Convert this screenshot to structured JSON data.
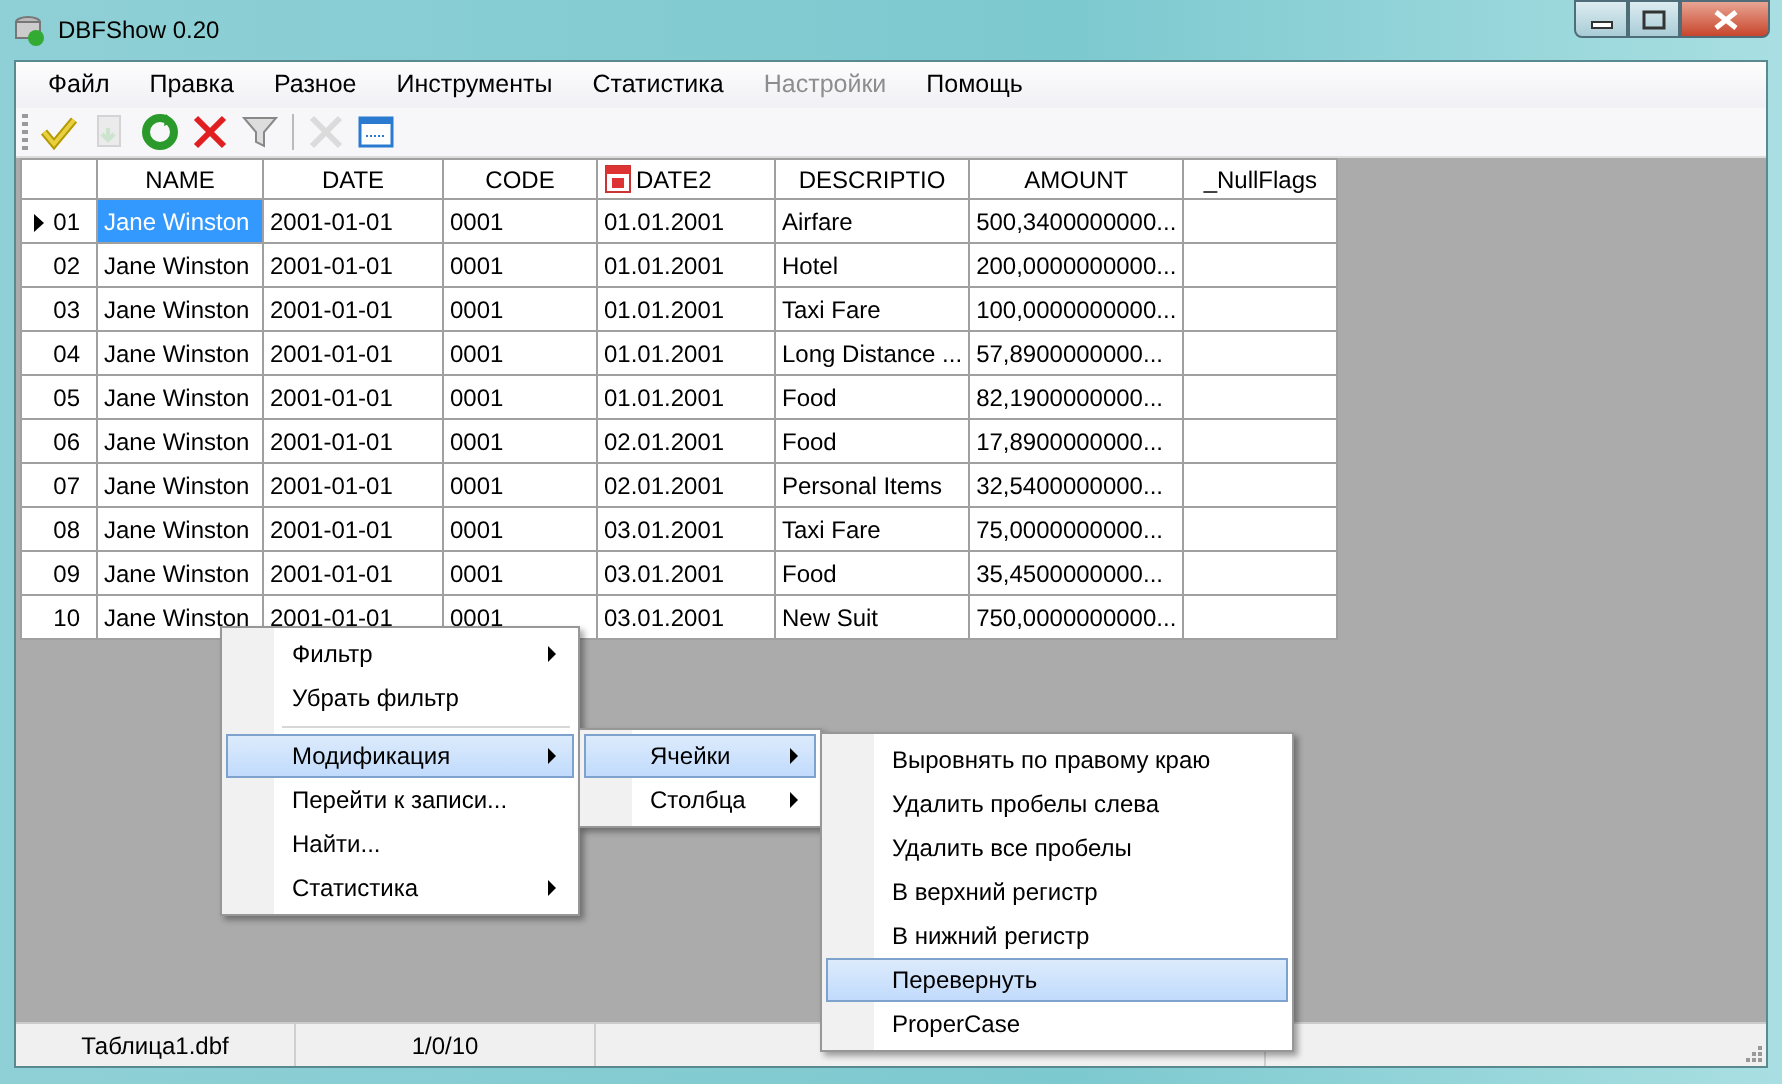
{
  "window": {
    "title": "DBFShow 0.20"
  },
  "menu": [
    {
      "label": "Файл",
      "disabled": false
    },
    {
      "label": "Правка",
      "disabled": false
    },
    {
      "label": "Разное",
      "disabled": false
    },
    {
      "label": "Инструменты",
      "disabled": false
    },
    {
      "label": "Статистика",
      "disabled": false
    },
    {
      "label": "Настройки",
      "disabled": true
    },
    {
      "label": "Помощь",
      "disabled": false
    }
  ],
  "toolbar": [
    {
      "kind": "open",
      "disabled": false
    },
    {
      "kind": "export",
      "disabled": true
    },
    {
      "kind": "refresh",
      "disabled": false
    },
    {
      "kind": "delete",
      "disabled": false
    },
    {
      "kind": "filter",
      "disabled": false
    },
    {
      "kind": "separator"
    },
    {
      "kind": "tools",
      "disabled": true
    },
    {
      "kind": "window",
      "disabled": false
    }
  ],
  "grid": {
    "columns": [
      {
        "label": "NAME",
        "kind": "text"
      },
      {
        "label": "DATE",
        "kind": "text"
      },
      {
        "label": "CODE",
        "kind": "text"
      },
      {
        "label": "DATE2",
        "kind": "date"
      },
      {
        "label": "DESCRIPTIO",
        "kind": "text"
      },
      {
        "label": "AMOUNT",
        "kind": "text"
      },
      {
        "label": "_NullFlags",
        "kind": "text"
      }
    ],
    "rows": [
      {
        "header": "01",
        "current": true,
        "cells": [
          {
            "text": "Jane Winston",
            "selected": true
          },
          {
            "text": "2001-01-01",
            "selected": false
          },
          {
            "text": "0001",
            "selected": false
          },
          {
            "text": "01.01.2001",
            "selected": false
          },
          {
            "text": "Airfare",
            "selected": false
          },
          {
            "text": "500,3400000000...",
            "selected": false
          },
          {
            "text": "",
            "selected": false
          }
        ]
      },
      {
        "header": "02",
        "current": false,
        "cells": [
          {
            "text": "Jane Winston",
            "selected": false
          },
          {
            "text": "2001-01-01",
            "selected": false
          },
          {
            "text": "0001",
            "selected": false
          },
          {
            "text": "01.01.2001",
            "selected": false
          },
          {
            "text": "Hotel",
            "selected": false
          },
          {
            "text": "200,0000000000...",
            "selected": false
          },
          {
            "text": "",
            "selected": false
          }
        ]
      },
      {
        "header": "03",
        "current": false,
        "cells": [
          {
            "text": "Jane Winston",
            "selected": false
          },
          {
            "text": "2001-01-01",
            "selected": false
          },
          {
            "text": "0001",
            "selected": false
          },
          {
            "text": "01.01.2001",
            "selected": false
          },
          {
            "text": "Taxi Fare",
            "selected": false
          },
          {
            "text": "100,0000000000...",
            "selected": false
          },
          {
            "text": "",
            "selected": false
          }
        ]
      },
      {
        "header": "04",
        "current": false,
        "cells": [
          {
            "text": "Jane Winston",
            "selected": false
          },
          {
            "text": "2001-01-01",
            "selected": false
          },
          {
            "text": "0001",
            "selected": false
          },
          {
            "text": "01.01.2001",
            "selected": false
          },
          {
            "text": "Long Distance ...",
            "selected": false
          },
          {
            "text": "57,8900000000...",
            "selected": false
          },
          {
            "text": "",
            "selected": false
          }
        ]
      },
      {
        "header": "05",
        "current": false,
        "cells": [
          {
            "text": "Jane Winston",
            "selected": false
          },
          {
            "text": "2001-01-01",
            "selected": false
          },
          {
            "text": "0001",
            "selected": false
          },
          {
            "text": "01.01.2001",
            "selected": false
          },
          {
            "text": "Food",
            "selected": false
          },
          {
            "text": "82,1900000000...",
            "selected": false
          },
          {
            "text": "",
            "selected": false
          }
        ]
      },
      {
        "header": "06",
        "current": false,
        "cells": [
          {
            "text": "Jane Winston",
            "selected": false
          },
          {
            "text": "2001-01-01",
            "selected": false
          },
          {
            "text": "0001",
            "selected": false
          },
          {
            "text": "02.01.2001",
            "selected": false
          },
          {
            "text": "Food",
            "selected": false
          },
          {
            "text": "17,8900000000...",
            "selected": false
          },
          {
            "text": "",
            "selected": false
          }
        ]
      },
      {
        "header": "07",
        "current": false,
        "cells": [
          {
            "text": "Jane Winston",
            "selected": false
          },
          {
            "text": "2001-01-01",
            "selected": false
          },
          {
            "text": "0001",
            "selected": false
          },
          {
            "text": "02.01.2001",
            "selected": false
          },
          {
            "text": "Personal Items",
            "selected": false
          },
          {
            "text": "32,5400000000...",
            "selected": false
          },
          {
            "text": "",
            "selected": false
          }
        ]
      },
      {
        "header": "08",
        "current": false,
        "cells": [
          {
            "text": "Jane Winston",
            "selected": false
          },
          {
            "text": "2001-01-01",
            "selected": false
          },
          {
            "text": "0001",
            "selected": false
          },
          {
            "text": "03.01.2001",
            "selected": false
          },
          {
            "text": "Taxi Fare",
            "selected": false
          },
          {
            "text": "75,0000000000...",
            "selected": false
          },
          {
            "text": "",
            "selected": false
          }
        ]
      },
      {
        "header": "09",
        "current": false,
        "cells": [
          {
            "text": "Jane Winston",
            "selected": false
          },
          {
            "text": "2001-01-01",
            "selected": false
          },
          {
            "text": "0001",
            "selected": false
          },
          {
            "text": "03.01.2001",
            "selected": false
          },
          {
            "text": "Food",
            "selected": false
          },
          {
            "text": "35,4500000000...",
            "selected": false
          },
          {
            "text": "",
            "selected": false
          }
        ]
      },
      {
        "header": "10",
        "current": false,
        "cells": [
          {
            "text": "Jane Winston",
            "selected": false
          },
          {
            "text": "2001-01-01",
            "selected": false
          },
          {
            "text": "0001",
            "selected": false
          },
          {
            "text": "03.01.2001",
            "selected": false
          },
          {
            "text": "New Suit",
            "selected": false
          },
          {
            "text": "750,0000000000...",
            "selected": false
          },
          {
            "text": "",
            "selected": false
          }
        ]
      }
    ]
  },
  "context_menu": [
    {
      "kind": "item",
      "label": "Фильтр",
      "has_submenu": true,
      "selected": false
    },
    {
      "kind": "item",
      "label": "Убрать фильтр",
      "has_submenu": false,
      "selected": false
    },
    {
      "kind": "separator"
    },
    {
      "kind": "item",
      "label": "Модификация",
      "has_submenu": true,
      "selected": true,
      "children": [
        {
          "kind": "item",
          "label": "Ячейки",
          "has_submenu": true,
          "selected": true,
          "children": [
            {
              "kind": "item",
              "label": "Выровнять по правому краю",
              "has_submenu": false,
              "selected": false
            },
            {
              "kind": "item",
              "label": "Удалить пробелы слева",
              "has_submenu": false,
              "selected": false
            },
            {
              "kind": "item",
              "label": "Удалить все пробелы",
              "has_submenu": false,
              "selected": false
            },
            {
              "kind": "item",
              "label": "В верхний регистр",
              "has_submenu": false,
              "selected": false
            },
            {
              "kind": "item",
              "label": "В нижний регистр",
              "has_submenu": false,
              "selected": false
            },
            {
              "kind": "item",
              "label": "Перевернуть",
              "has_submenu": false,
              "selected": true
            },
            {
              "kind": "item",
              "label": "ProperCase",
              "has_submenu": false,
              "selected": false
            }
          ]
        },
        {
          "kind": "item",
          "label": "Столбца",
          "has_submenu": true,
          "selected": false
        }
      ]
    },
    {
      "kind": "item",
      "label": "Перейти к записи...",
      "has_submenu": false,
      "selected": false
    },
    {
      "kind": "item",
      "label": "Найти...",
      "has_submenu": false,
      "selected": false
    },
    {
      "kind": "item",
      "label": "Статистика",
      "has_submenu": true,
      "selected": false
    }
  ],
  "status_bar": [
    "Таблица1.dbf",
    "1/0/10"
  ]
}
